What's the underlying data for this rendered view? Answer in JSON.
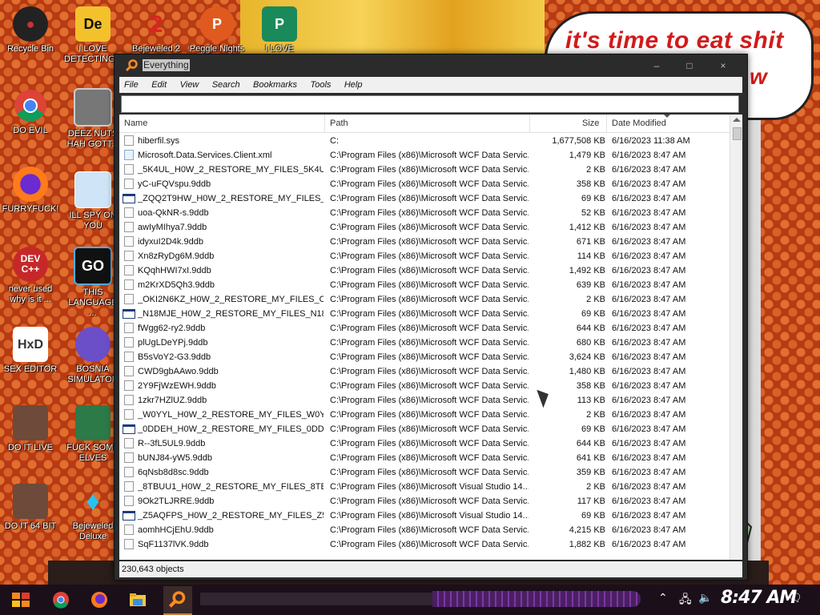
{
  "wallpaper": {
    "speech_text": "it's time to eat shit",
    "speech_text_tail": "w"
  },
  "desktop_icons": [
    {
      "label": "Recycle Bin"
    },
    {
      "label": "I LOVE DETECTING..."
    },
    {
      "label": "Bejeweled 2"
    },
    {
      "label": "Peggle Nights"
    },
    {
      "label": "I LOVE"
    },
    {
      "label": "DO EVIL"
    },
    {
      "label": "DEEZ NUTS HAH GOTT..."
    },
    {
      "label": "FURRYFUCK!"
    },
    {
      "label": "ILL SPY ON YOU"
    },
    {
      "label": "never used why is it ..."
    },
    {
      "label": "THIS LANGUAGE ..."
    },
    {
      "label": "SEX EDITOR"
    },
    {
      "label": "BOSNIA SIMULATOR"
    },
    {
      "label": "DO IT LIVE"
    },
    {
      "label": "FUCK SOME ELVES"
    },
    {
      "label": "DO IT 64 BIT"
    },
    {
      "label": "Bejeweled Deluxe"
    }
  ],
  "window": {
    "title": "Everything",
    "menu": [
      "File",
      "Edit",
      "View",
      "Search",
      "Bookmarks",
      "Tools",
      "Help"
    ],
    "search_value": "",
    "columns": {
      "name": "Name",
      "path": "Path",
      "size": "Size",
      "date": "Date Modified"
    },
    "rows": [
      {
        "icon": "file",
        "name": "hiberfil.sys",
        "path": "C:",
        "size": "1,677,508 KB",
        "date": "6/16/2023 11:38 AM"
      },
      {
        "icon": "xml",
        "name": "Microsoft.Data.Services.Client.xml",
        "path": "C:\\Program Files (x86)\\Microsoft WCF Data Servic...",
        "size": "1,479 KB",
        "date": "6/16/2023 8:47 AM"
      },
      {
        "icon": "file",
        "name": "_5K4UL_H0W_2_RESTORE_MY_FILES_5K4UL_...",
        "path": "C:\\Program Files (x86)\\Microsoft WCF Data Servic...",
        "size": "2 KB",
        "date": "6/16/2023 8:47 AM"
      },
      {
        "icon": "file",
        "name": "yC-uFQVspu.9ddb",
        "path": "C:\\Program Files (x86)\\Microsoft WCF Data Servic...",
        "size": "358 KB",
        "date": "6/16/2023 8:47 AM"
      },
      {
        "icon": "win",
        "name": "_ZQQ2T9HW_H0W_2_RESTORE_MY_FILES_ZQ...",
        "path": "C:\\Program Files (x86)\\Microsoft WCF Data Servic...",
        "size": "69 KB",
        "date": "6/16/2023 8:47 AM"
      },
      {
        "icon": "file",
        "name": "uoa-QkNR-s.9ddb",
        "path": "C:\\Program Files (x86)\\Microsoft WCF Data Servic...",
        "size": "52 KB",
        "date": "6/16/2023 8:47 AM"
      },
      {
        "icon": "file",
        "name": "awIyMIhya7.9ddb",
        "path": "C:\\Program Files (x86)\\Microsoft WCF Data Servic...",
        "size": "1,412 KB",
        "date": "6/16/2023 8:47 AM"
      },
      {
        "icon": "file",
        "name": "idyxuI2D4k.9ddb",
        "path": "C:\\Program Files (x86)\\Microsoft WCF Data Servic...",
        "size": "671 KB",
        "date": "6/16/2023 8:47 AM"
      },
      {
        "icon": "file",
        "name": "Xn8zRyDg6M.9ddb",
        "path": "C:\\Program Files (x86)\\Microsoft WCF Data Servic...",
        "size": "114 KB",
        "date": "6/16/2023 8:47 AM"
      },
      {
        "icon": "file",
        "name": "KQqhHWI7xI.9ddb",
        "path": "C:\\Program Files (x86)\\Microsoft WCF Data Servic...",
        "size": "1,492 KB",
        "date": "6/16/2023 8:47 AM"
      },
      {
        "icon": "file",
        "name": "m2KrXD5Qh3.9ddb",
        "path": "C:\\Program Files (x86)\\Microsoft WCF Data Servic...",
        "size": "639 KB",
        "date": "6/16/2023 8:47 AM"
      },
      {
        "icon": "file",
        "name": "_OKI2N6KZ_H0W_2_RESTORE_MY_FILES_OKI...",
        "path": "C:\\Program Files (x86)\\Microsoft WCF Data Servic...",
        "size": "2 KB",
        "date": "6/16/2023 8:47 AM"
      },
      {
        "icon": "win",
        "name": "_N18MJE_H0W_2_RESTORE_MY_FILES_N18M...",
        "path": "C:\\Program Files (x86)\\Microsoft WCF Data Servic...",
        "size": "69 KB",
        "date": "6/16/2023 8:47 AM"
      },
      {
        "icon": "file",
        "name": "fWgg62-ry2.9ddb",
        "path": "C:\\Program Files (x86)\\Microsoft WCF Data Servic...",
        "size": "644 KB",
        "date": "6/16/2023 8:47 AM"
      },
      {
        "icon": "file",
        "name": "plUgLDeYPj.9ddb",
        "path": "C:\\Program Files (x86)\\Microsoft WCF Data Servic...",
        "size": "680 KB",
        "date": "6/16/2023 8:47 AM"
      },
      {
        "icon": "file",
        "name": "B5sVoY2-G3.9ddb",
        "path": "C:\\Program Files (x86)\\Microsoft WCF Data Servic...",
        "size": "3,624 KB",
        "date": "6/16/2023 8:47 AM"
      },
      {
        "icon": "file",
        "name": "CWD9gbAAwo.9ddb",
        "path": "C:\\Program Files (x86)\\Microsoft WCF Data Servic...",
        "size": "1,480 KB",
        "date": "6/16/2023 8:47 AM"
      },
      {
        "icon": "file",
        "name": "2Y9FjWzEWH.9ddb",
        "path": "C:\\Program Files (x86)\\Microsoft WCF Data Servic...",
        "size": "358 KB",
        "date": "6/16/2023 8:47 AM"
      },
      {
        "icon": "file",
        "name": "1zkr7HZlUZ.9ddb",
        "path": "C:\\Program Files (x86)\\Microsoft WCF Data Servic...",
        "size": "113 KB",
        "date": "6/16/2023 8:47 AM"
      },
      {
        "icon": "file",
        "name": "_W0YYL_H0W_2_RESTORE_MY_FILES_W0YYL...",
        "path": "C:\\Program Files (x86)\\Microsoft WCF Data Servic...",
        "size": "2 KB",
        "date": "6/16/2023 8:47 AM"
      },
      {
        "icon": "win",
        "name": "_0DDEH_H0W_2_RESTORE_MY_FILES_0DDEH...",
        "path": "C:\\Program Files (x86)\\Microsoft WCF Data Servic...",
        "size": "69 KB",
        "date": "6/16/2023 8:47 AM"
      },
      {
        "icon": "file",
        "name": "R--3fL5UL9.9ddb",
        "path": "C:\\Program Files (x86)\\Microsoft WCF Data Servic...",
        "size": "644 KB",
        "date": "6/16/2023 8:47 AM"
      },
      {
        "icon": "file",
        "name": "bUNJ84-yW5.9ddb",
        "path": "C:\\Program Files (x86)\\Microsoft WCF Data Servic...",
        "size": "641 KB",
        "date": "6/16/2023 8:47 AM"
      },
      {
        "icon": "file",
        "name": "6qNsb8d8sc.9ddb",
        "path": "C:\\Program Files (x86)\\Microsoft WCF Data Servic...",
        "size": "359 KB",
        "date": "6/16/2023 8:47 AM"
      },
      {
        "icon": "file",
        "name": "_8TBUU1_H0W_2_RESTORE_MY_FILES_8TBU...",
        "path": "C:\\Program Files (x86)\\Microsoft Visual Studio 14....",
        "size": "2 KB",
        "date": "6/16/2023 8:47 AM"
      },
      {
        "icon": "file",
        "name": "9Ok2TLJRRE.9ddb",
        "path": "C:\\Program Files (x86)\\Microsoft WCF Data Servic...",
        "size": "117 KB",
        "date": "6/16/2023 8:47 AM"
      },
      {
        "icon": "win",
        "name": "_Z5AQFPS_H0W_2_RESTORE_MY_FILES_Z5AQ...",
        "path": "C:\\Program Files (x86)\\Microsoft Visual Studio 14....",
        "size": "69 KB",
        "date": "6/16/2023 8:47 AM"
      },
      {
        "icon": "file",
        "name": "aomhHCjEhU.9ddb",
        "path": "C:\\Program Files (x86)\\Microsoft WCF Data Servic...",
        "size": "4,215 KB",
        "date": "6/16/2023 8:47 AM"
      },
      {
        "icon": "file",
        "name": "SqF1137lVK.9ddb",
        "path": "C:\\Program Files (x86)\\Microsoft WCF Data Servic...",
        "size": "1,882 KB",
        "date": "6/16/2023 8:47 AM"
      }
    ],
    "status": "230,643 objects"
  },
  "taskbar": {
    "time": "8:47 AM"
  }
}
